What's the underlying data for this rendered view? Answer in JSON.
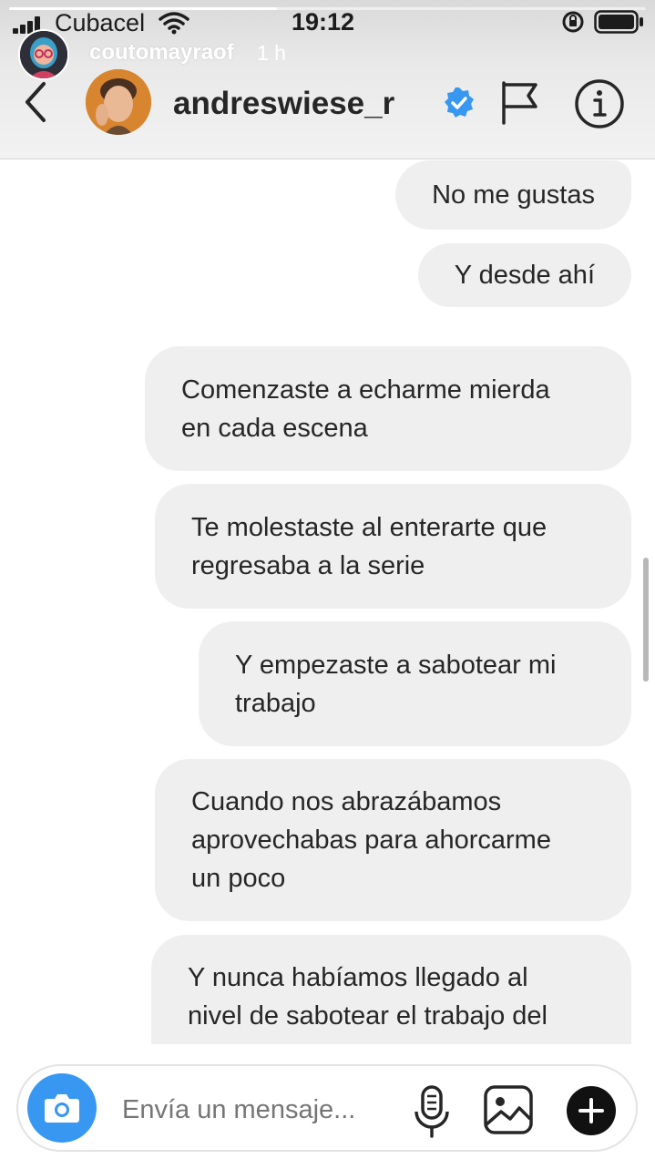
{
  "status_bar": {
    "carrier": "Cubacel",
    "time": "19:12"
  },
  "story": {
    "username": "coutomayraof",
    "time_ago": "1 h",
    "progress": 0.42
  },
  "dm_header": {
    "username": "andreswiese_r",
    "verified": true,
    "icons": [
      "back-icon",
      "verified-badge-icon",
      "flag-icon",
      "info-icon"
    ]
  },
  "messages": [
    {
      "text": "No me gustas",
      "sender": "me"
    },
    {
      "text": "Y desde ahí",
      "sender": "me"
    },
    {
      "text": "Comenzaste a echarme mierda\nen cada escena",
      "sender": "me"
    },
    {
      "text": "Te molestaste al enterarte que\nregresaba a la serie",
      "sender": "me"
    },
    {
      "text": "Y empezaste a sabotear mi\ntrabajo",
      "sender": "me"
    },
    {
      "text": "Cuando nos abrazábamos\naprovechabas para ahorcarme\nun poco",
      "sender": "me"
    },
    {
      "text": "Y nunca habíamos llegado al\nnivel de sabotear el trabajo del",
      "sender": "me"
    }
  ],
  "composer": {
    "placeholder": "Envía un mensaje...",
    "icons": [
      "camera-icon",
      "mic-icon",
      "gallery-icon",
      "plus-icon"
    ]
  },
  "colors": {
    "accent": "#3897f0",
    "bubble": "#efefef",
    "text": "#262626",
    "placeholder": "#8e8e8e"
  }
}
